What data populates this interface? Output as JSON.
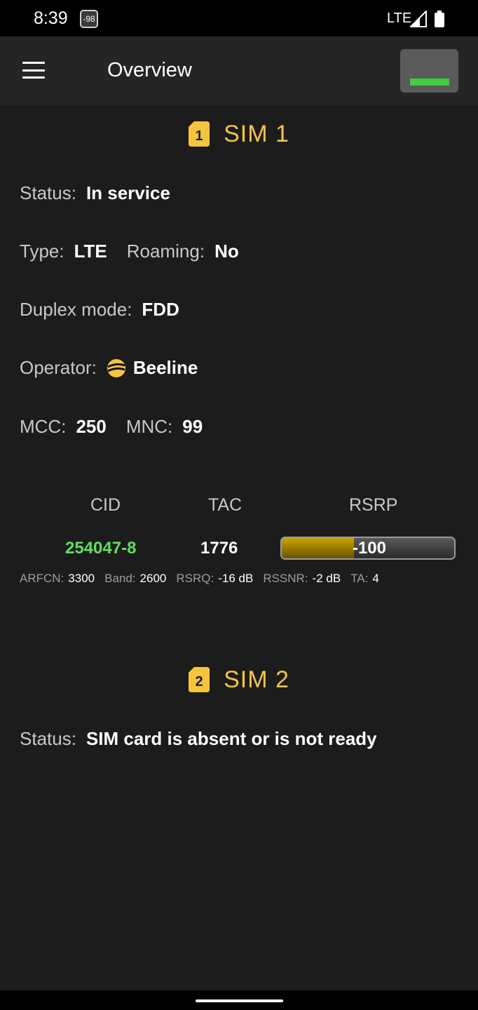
{
  "status_bar": {
    "time": "8:39",
    "badge": "-98",
    "network": "LTE"
  },
  "appbar": {
    "title": "Overview"
  },
  "sim1": {
    "number": "1",
    "title": "SIM 1",
    "status_label": "Status:",
    "status_value": "In service",
    "type_label": "Type:",
    "type_value": "LTE",
    "roaming_label": "Roaming:",
    "roaming_value": "No",
    "duplex_label": "Duplex mode:",
    "duplex_value": "FDD",
    "operator_label": "Operator:",
    "operator_value": "Beeline",
    "operator_icon": "beeline-logo-icon",
    "mcc_label": "MCC:",
    "mcc_value": "250",
    "mnc_label": "MNC:",
    "mnc_value": "99",
    "cell": {
      "headers": {
        "cid": "CID",
        "tac": "TAC",
        "rsrp": "RSRP"
      },
      "cid": "254047-8",
      "tac": "1776",
      "rsrp": "-100",
      "rsrp_level": 0.42,
      "arfcn_label": "ARFCN:",
      "arfcn": "3300",
      "band_label": "Band:",
      "band": "2600",
      "rsrq_label": "RSRQ:",
      "rsrq": "-16 dB",
      "rssnr_label": "RSSNR:",
      "rssnr": "-2 dB",
      "ta_label": "TA:",
      "ta": "4"
    }
  },
  "sim2": {
    "number": "2",
    "title": "SIM 2",
    "status_label": "Status:",
    "status_value": "SIM card is absent or is not ready"
  },
  "colors": {
    "accent": "#f5c542",
    "cid_good": "#5fe05f",
    "indicator": "#3fcf3f",
    "rsrp_fill": "#c9a400"
  }
}
